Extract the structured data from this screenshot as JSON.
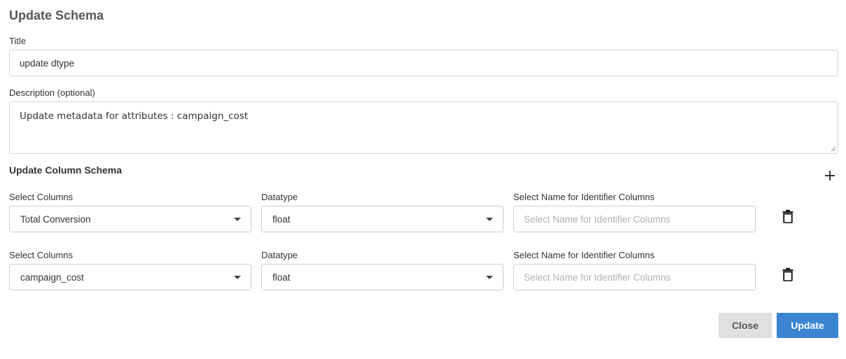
{
  "dialog": {
    "title": "Update Schema"
  },
  "form": {
    "title_label": "Title",
    "title_value": "update dtype",
    "description_label": "Description (optional)",
    "description_value": "Update metadata for attributes : campaign_cost"
  },
  "schema": {
    "section_title": "Update Column Schema",
    "add_icon": "plus-icon",
    "rows": [
      {
        "columns_label": "Select Columns",
        "columns_value": "Total Conversion",
        "datatype_label": "Datatype",
        "datatype_value": "float",
        "identifier_label": "Select Name for Identifier Columns",
        "identifier_placeholder": "Select Name for Identifier Columns",
        "delete_icon": "trash-icon"
      },
      {
        "columns_label": "Select Columns",
        "columns_value": "campaign_cost",
        "datatype_label": "Datatype",
        "datatype_value": "float",
        "identifier_label": "Select Name for Identifier Columns",
        "identifier_placeholder": "Select Name for Identifier Columns",
        "delete_icon": "trash-icon"
      }
    ]
  },
  "footer": {
    "close_label": "Close",
    "update_label": "Update"
  },
  "colors": {
    "primary": "#3a84d0",
    "secondary_button": "#e0e0e0"
  }
}
